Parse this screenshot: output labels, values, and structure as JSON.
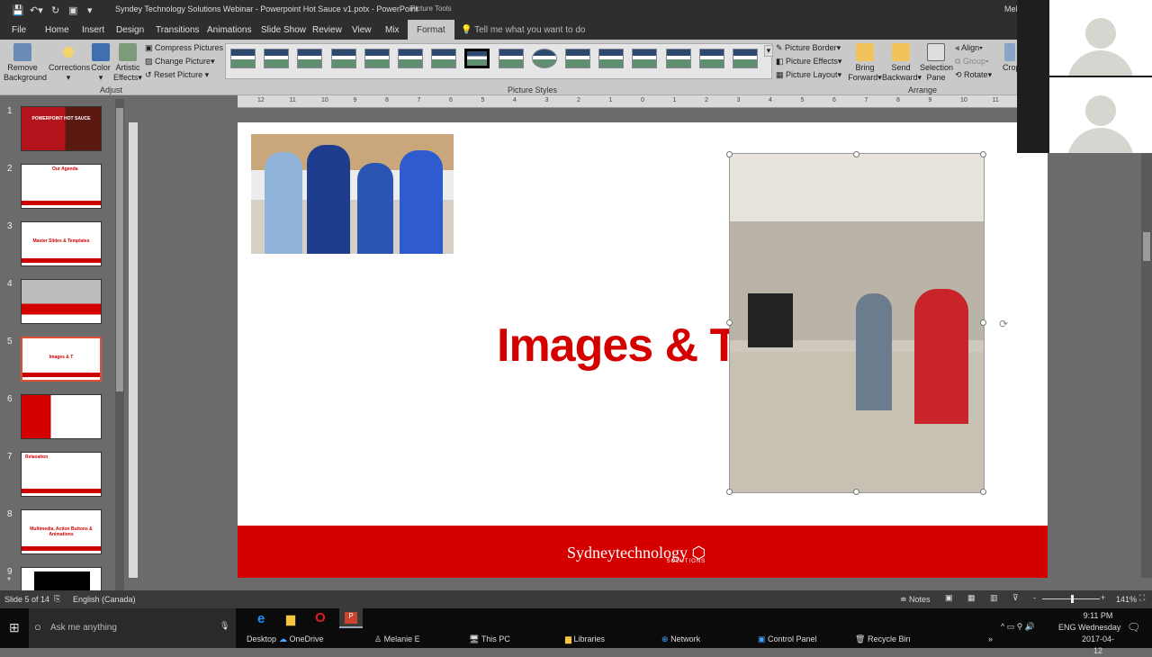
{
  "window": {
    "title": "Syndey Technology Solutions Webinar - Powerpoint Hot Sauce  v1.potx  -  PowerPoint",
    "context_tab": "Picture Tools",
    "user": "Mel"
  },
  "tabs": [
    "File",
    "Home",
    "Insert",
    "Design",
    "Transitions",
    "Animations",
    "Slide Show",
    "Review",
    "View",
    "Mix",
    "Format"
  ],
  "active_tab": "Format",
  "tell_me": "Tell me what you want to do",
  "ribbon": {
    "adjust": {
      "remove_bg": [
        "Remove",
        "Background"
      ],
      "corrections": "Corrections",
      "color": "Color",
      "artistic": [
        "Artistic",
        "Effects"
      ],
      "compress": "Compress Pictures",
      "change": "Change Picture",
      "reset": "Reset Picture",
      "group": "Adjust"
    },
    "styles": {
      "group": "Picture Styles",
      "border": "Picture Border",
      "effects": "Picture Effects",
      "layout": "Picture Layout",
      "count": 16
    },
    "arrange": {
      "bring": [
        "Bring",
        "Forward"
      ],
      "send": [
        "Send",
        "Backward"
      ],
      "selection": [
        "Selection",
        "Pane"
      ],
      "align": "Align",
      "group_btn": "Group",
      "rotate": "Rotate",
      "group": "Arrange"
    },
    "crop": "Crop"
  },
  "ruler_h": [
    "12",
    "11",
    "10",
    "9",
    "8",
    "7",
    "6",
    "5",
    "4",
    "3",
    "2",
    "1",
    "0",
    "1",
    "2",
    "3",
    "4",
    "5",
    "6",
    "7",
    "8",
    "9",
    "10",
    "11"
  ],
  "slides": [
    {
      "n": "1",
      "label": "POWERPOINT HOT SAUCE"
    },
    {
      "n": "2",
      "label": "Our Agenda"
    },
    {
      "n": "3",
      "label": "Master Slides & Templates"
    },
    {
      "n": "4",
      "label": ""
    },
    {
      "n": "5",
      "label": "Images & T"
    },
    {
      "n": "6",
      "label": ""
    },
    {
      "n": "7",
      "label": "Relaxation"
    },
    {
      "n": "8",
      "label": "Multimedia, Action Buttons & Animations"
    },
    {
      "n": "9",
      "label": ""
    }
  ],
  "slide": {
    "title": "Images & Te",
    "logo": "Sydneytechnology",
    "logo_sub": "SOLUTIONS",
    "red": "#d40000"
  },
  "status": {
    "slide": "Slide 5 of 14",
    "language": "English (Canada)",
    "notes": "Notes",
    "zoom": "141%"
  },
  "taskbar": {
    "search": "Ask me anything",
    "items": [
      "Desktop",
      "OneDrive",
      "Melanie E",
      "This PC",
      "Libraries",
      "Network",
      "Control Panel",
      "Recycle Bin"
    ],
    "lang": "ENG",
    "time": "9:11 PM",
    "day": "Wednesday",
    "date": "2017-04-12"
  }
}
